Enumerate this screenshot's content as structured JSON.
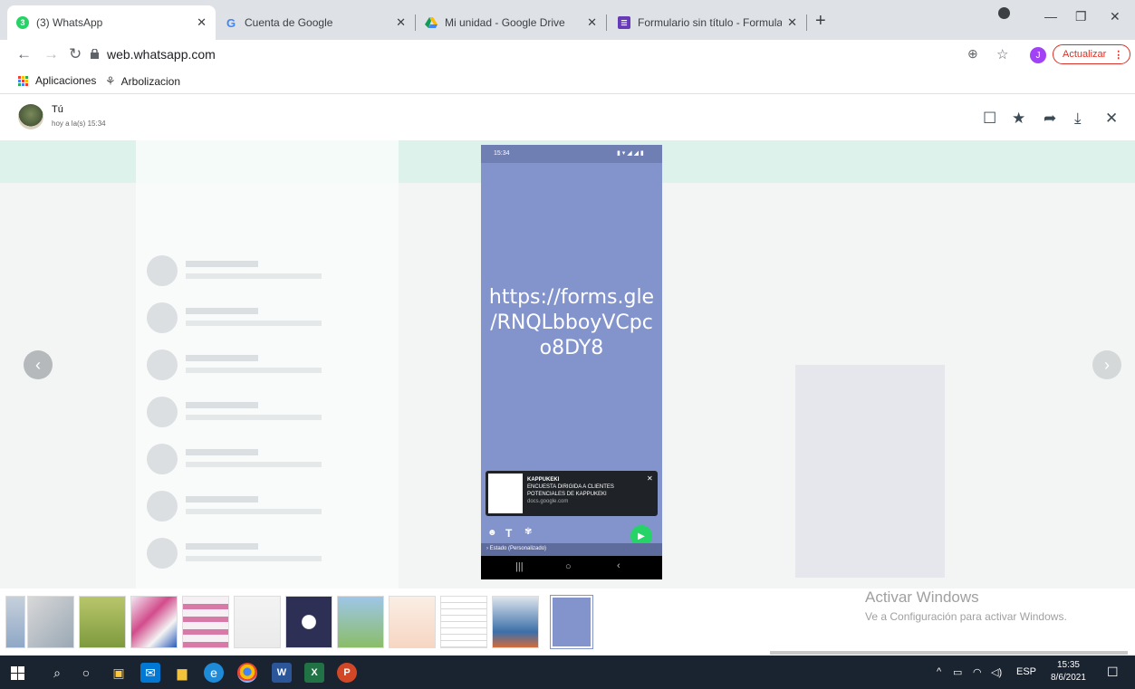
{
  "browser": {
    "tabs": [
      {
        "title": "(3) WhatsApp",
        "badge": "3",
        "active": true
      },
      {
        "title": "Cuenta de Google",
        "active": false
      },
      {
        "title": "Mi unidad - Google Drive",
        "active": false
      },
      {
        "title": "Formulario sin título - Formulario",
        "active": false
      }
    ],
    "url": "web.whatsapp.com",
    "profile_initial": "J",
    "update_label": "Actualizar",
    "bookmarks": [
      "Aplicaciones",
      "Arbolizacion"
    ]
  },
  "viewer": {
    "sender": "Tú",
    "time": "hoy a la(s) 15:34"
  },
  "phone": {
    "status_time": "15:34",
    "link_text": "https://forms.gle/RNQLbboyVCpco8DY8",
    "link_lines": [
      "https://forms.gle",
      "/RNQLbboyVCpc",
      "o8DY8"
    ],
    "card_title": "KAPPUKEKI",
    "card_desc1": "ENCUESTA DIRIGIDA A CLIENTES",
    "card_desc2": "POTENCIALES DE KAPPUKEKI",
    "card_domain": "docs.google.com",
    "state_label": "Estado (Personalizado)"
  },
  "windows_notice": {
    "title": "Activar Windows",
    "subtitle": "Ve a Configuración para activar Windows."
  },
  "taskbar": {
    "lang": "ESP",
    "time": "15:35",
    "date": "8/6/2021"
  },
  "colors": {
    "phone_bg": "#8394cd",
    "whatsapp_green": "#25d366",
    "taskbar": "#1a2330"
  }
}
